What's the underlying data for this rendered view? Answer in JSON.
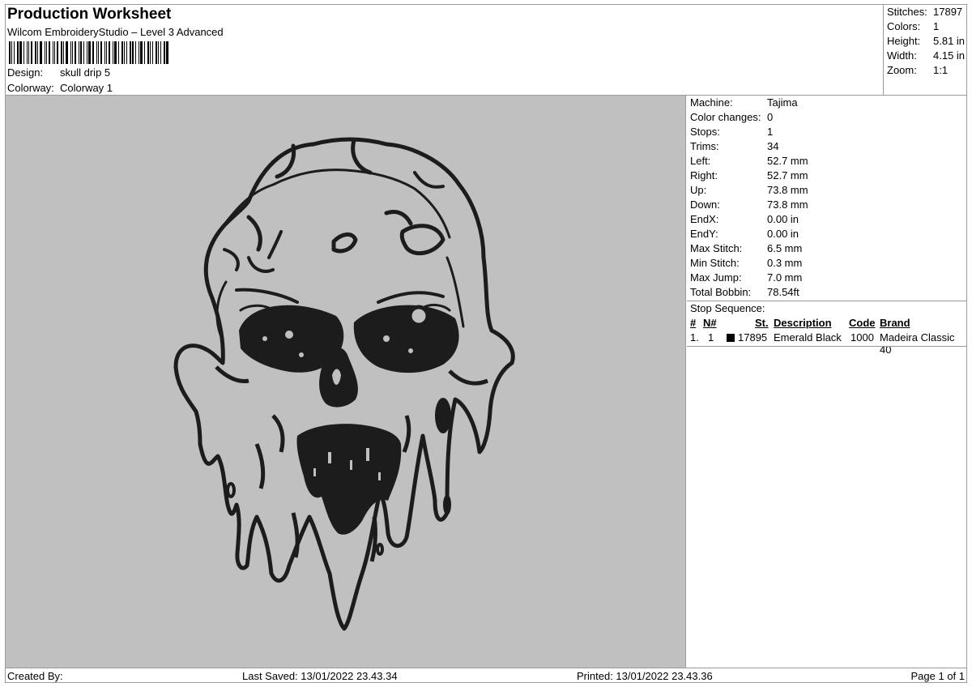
{
  "header": {
    "title": "Production Worksheet",
    "subtitle": "Wilcom EmbroideryStudio – Level 3 Advanced",
    "design_label": "Design:",
    "design_value": "skull drip 5",
    "colorway_label": "Colorway:",
    "colorway_value": "Colorway 1"
  },
  "stats": [
    {
      "label": "Stitches:",
      "value": "17897"
    },
    {
      "label": "Colors:",
      "value": "1"
    },
    {
      "label": "Height:",
      "value": "5.81 in"
    },
    {
      "label": "Width:",
      "value": "4.15 in"
    },
    {
      "label": "Zoom:",
      "value": "1:1"
    }
  ],
  "machine_info": [
    {
      "label": "Machine:",
      "value": "Tajima"
    },
    {
      "label": "Color changes:",
      "value": "0"
    },
    {
      "label": "Stops:",
      "value": "1"
    },
    {
      "label": "Trims:",
      "value": "34"
    },
    {
      "label": "Left:",
      "value": "52.7 mm"
    },
    {
      "label": "Right:",
      "value": "52.7 mm"
    },
    {
      "label": "Up:",
      "value": "73.8 mm"
    },
    {
      "label": "Down:",
      "value": "73.8 mm"
    },
    {
      "label": "EndX:",
      "value": "0.00 in"
    },
    {
      "label": "EndY:",
      "value": "0.00 in"
    },
    {
      "label": "Max Stitch:",
      "value": "6.5 mm"
    },
    {
      "label": "Min Stitch:",
      "value": "0.3 mm"
    },
    {
      "label": "Max Jump:",
      "value": "7.0 mm"
    },
    {
      "label": "Total Bobbin:",
      "value": "78.54ft"
    }
  ],
  "stop_sequence": {
    "title": "Stop Sequence:",
    "headers": {
      "num": "#",
      "n": "N#",
      "st": "St.",
      "description": "Description",
      "code": "Code",
      "brand": "Brand"
    },
    "rows": [
      {
        "num": "1.",
        "n": "1",
        "color": "#000000",
        "st": "17895",
        "description": "Emerald Black",
        "code": "1000",
        "brand": "Madeira Classic 40"
      }
    ]
  },
  "footer": {
    "created_by": "Created By:",
    "last_saved": "Last Saved: 13/01/2022 23.43.34",
    "printed": "Printed: 13/01/2022 23.43.36",
    "page": "Page 1 of 1"
  },
  "colors": {
    "design_background": "#c0c0c0",
    "thread": "#1c1c1c"
  }
}
